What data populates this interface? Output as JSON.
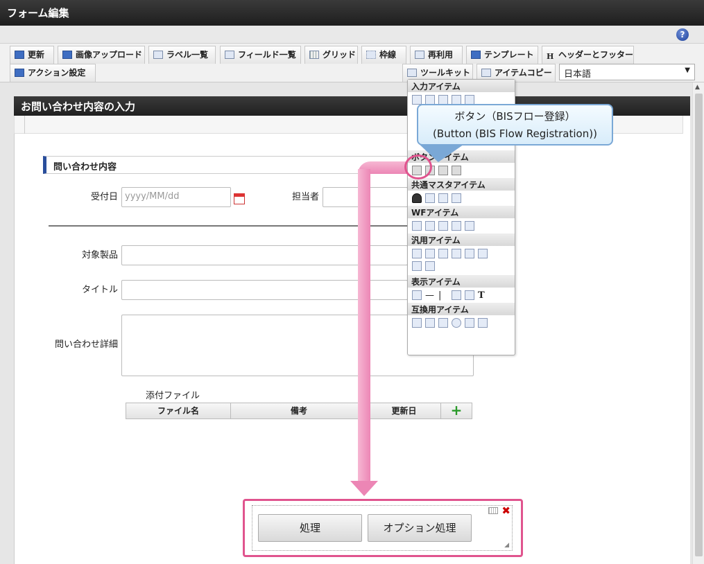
{
  "window": {
    "title": "フォーム編集"
  },
  "toolbar": {
    "row1": [
      "更新",
      "画像アップロード",
      "ラベル一覧",
      "フィールド一覧",
      "グリッド",
      "枠線",
      "再利用",
      "テンプレート",
      "ヘッダーとフッター"
    ],
    "row2_left": "アクション設定",
    "toolkit": "ツールキット",
    "item_copy": "アイテムコピー",
    "language": "日本語",
    "help": "?"
  },
  "form": {
    "section_title": "お問い合わせ内容の入力",
    "group_title": "問い合わせ内容",
    "fields": {
      "received_date_label": "受付日",
      "received_date_placeholder": "yyyy/MM/dd",
      "person_label": "担当者",
      "product_label": "対象製品",
      "title_label": "タイトル",
      "detail_label": "問い合わせ詳細"
    },
    "attachment": {
      "label": "添付ファイル",
      "columns": [
        "ファイル名",
        "備考",
        "更新日"
      ]
    },
    "buttons": [
      "処理",
      "オプション処理"
    ]
  },
  "palette": {
    "sections": [
      "入力アイテム",
      "ボタンアイテム",
      "共通マスタアイテム",
      "WFアイテム",
      "汎用アイテム",
      "表示アイテム",
      "互換用アイテム"
    ]
  },
  "tooltip": {
    "line1": "ボタン（BISフロー登録）",
    "line2": "(Button (BIS Flow Registration))"
  },
  "colors": {
    "highlight": "#e0548e",
    "accent": "#2a4e9c"
  }
}
